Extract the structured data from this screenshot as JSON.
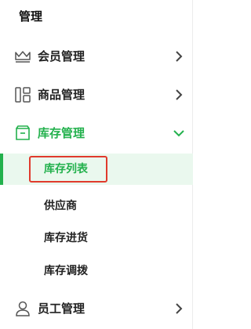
{
  "sidebar": {
    "title": "管理",
    "menus": [
      {
        "label": "会员管理",
        "icon": "crown-icon"
      },
      {
        "label": "商品管理",
        "icon": "grid-icon"
      },
      {
        "label": "库存管理",
        "icon": "box-icon",
        "expanded": true
      },
      {
        "label": "员工管理",
        "icon": "user-icon"
      }
    ],
    "inventory_sub": [
      {
        "label": "库存列表",
        "selected": true
      },
      {
        "label": "供应商"
      },
      {
        "label": "库存进货"
      },
      {
        "label": "库存调拨"
      }
    ]
  },
  "colors": {
    "accent": "#23b14d",
    "selected_bg": "#eaf8ee",
    "highlight": "#e03a2c"
  }
}
